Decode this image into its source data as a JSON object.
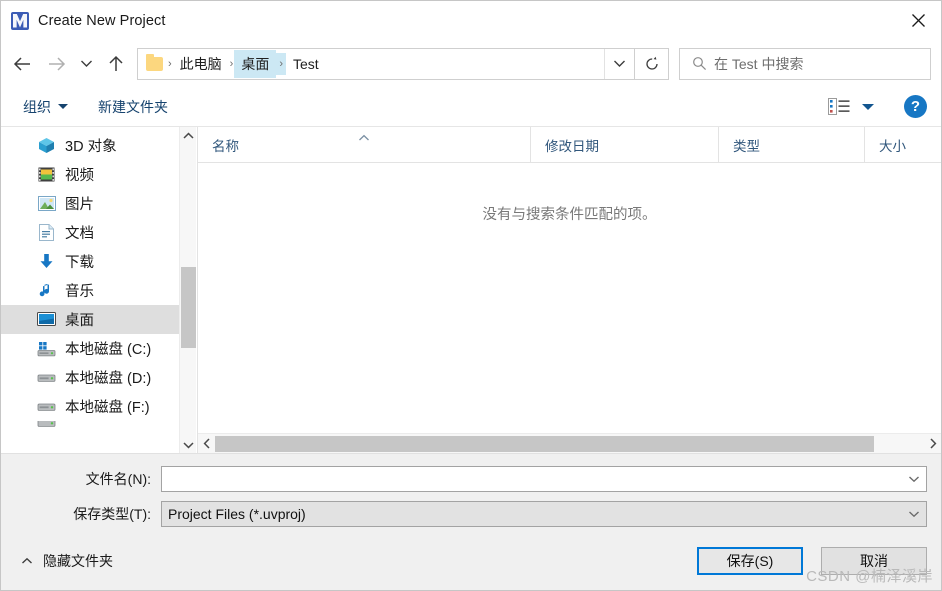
{
  "window": {
    "title": "Create New Project",
    "app_icon": "uvision-icon",
    "close_label": "×"
  },
  "nav": {
    "back_icon": "arrow-left-icon",
    "forward_icon": "arrow-right-icon",
    "recent_icon": "chevron-down-icon",
    "up_icon": "arrow-up-icon",
    "refresh_icon": "refresh-icon",
    "address_chevron_icon": "chevron-down-icon",
    "breadcrumbs": [
      {
        "label": "此电脑",
        "selected": false
      },
      {
        "label": "桌面",
        "selected": true
      },
      {
        "label": "Test",
        "selected": false
      }
    ],
    "separator": "›"
  },
  "search": {
    "placeholder": "在 Test 中搜索",
    "icon": "search-icon"
  },
  "toolbar": {
    "organize_label": "组织",
    "new_folder_label": "新建文件夹",
    "view_icon": "list-view-icon",
    "help_label": "?"
  },
  "sidebar": {
    "items": [
      {
        "label": "3D 对象",
        "icon": "cube-icon",
        "selected": false
      },
      {
        "label": "视频",
        "icon": "video-icon",
        "selected": false
      },
      {
        "label": "图片",
        "icon": "pictures-icon",
        "selected": false
      },
      {
        "label": "文档",
        "icon": "documents-icon",
        "selected": false
      },
      {
        "label": "下载",
        "icon": "downloads-icon",
        "selected": false
      },
      {
        "label": "音乐",
        "icon": "music-icon",
        "selected": false
      },
      {
        "label": "桌面",
        "icon": "desktop-icon",
        "selected": true
      },
      {
        "label": "本地磁盘 (C:)",
        "icon": "system-drive-icon",
        "selected": false
      },
      {
        "label": "本地磁盘 (D:)",
        "icon": "drive-icon",
        "selected": false
      },
      {
        "label": "本地磁盘 (F:)",
        "icon": "drive-icon",
        "selected": false
      }
    ],
    "scroll_up_icon": "chevron-up-icon",
    "scroll_down_icon": "chevron-down-icon"
  },
  "filelist": {
    "columns": [
      {
        "label": "名称",
        "sorted": "asc"
      },
      {
        "label": "修改日期",
        "sorted": ""
      },
      {
        "label": "类型",
        "sorted": ""
      },
      {
        "label": "大小",
        "sorted": ""
      }
    ],
    "rows": [],
    "empty_message": "没有与搜索条件匹配的项。",
    "scroll_left_icon": "chevron-left-icon",
    "scroll_right_icon": "chevron-right-icon"
  },
  "form": {
    "filename_label": "文件名(N):",
    "filename_value": "",
    "filetype_label": "保存类型(T):",
    "filetype_value": "Project Files (*.uvproj)",
    "dropdown_icon": "chevron-down-icon"
  },
  "footer": {
    "hide_folders_label": "隐藏文件夹",
    "hide_folders_icon": "chevron-up-icon",
    "save_label": "保存(S)",
    "cancel_label": "取消"
  },
  "watermark": "CSDN @楠泽溪岸",
  "colors": {
    "accent": "#0078d7",
    "crumb_selected": "#cce8f4",
    "row_selected": "#dedede",
    "toolbar_text": "#16436e",
    "column_text": "#31577c"
  }
}
